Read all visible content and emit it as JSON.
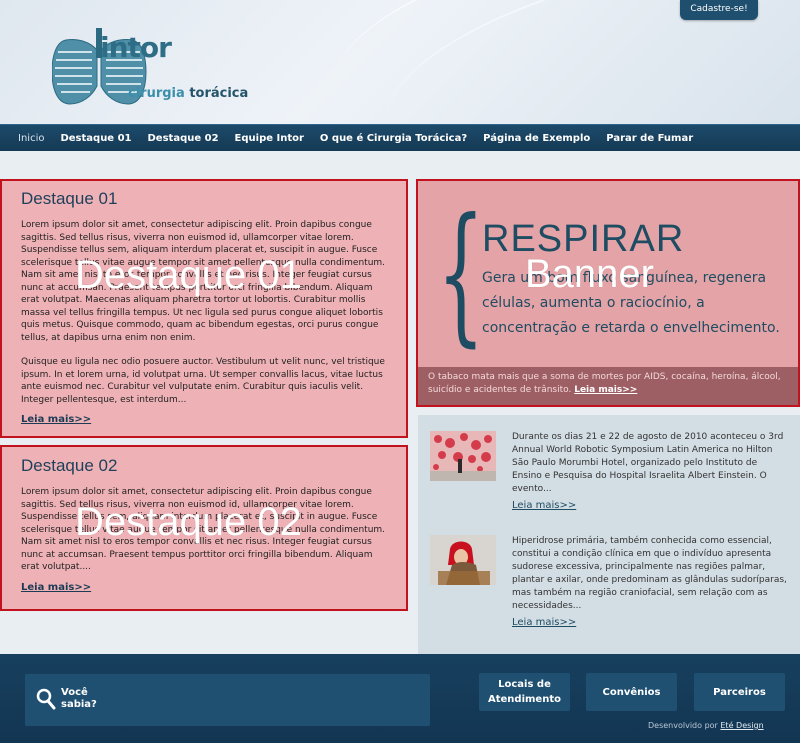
{
  "header": {
    "register_label": "Cadastre-se!",
    "logo_word": "intor",
    "logo_sub_1": "cirurgia",
    "logo_sub_2": "torácica"
  },
  "nav": {
    "items": [
      "Inicio",
      "Destaque 01",
      "Destaque 02",
      "Equipe Intor",
      "O que é Cirurgia Torácica?",
      "Página de Exemplo",
      "Parar de Fumar"
    ]
  },
  "featured1": {
    "title": "Destaque 01",
    "paragraph1": "Lorem ipsum dolor sit amet, consectetur adipiscing elit. Proin dapibus congue sagittis. Sed tellus risus, viverra non euismod id, ullamcorper vitae lorem. Suspendisse tellus sem, aliquam interdum placerat et, suscipit in augue. Fusce scelerisque tellus vitae augue tempor sit amet pellentesque nulla condimentum. Nam sit amet nisl to eros tempor convallis et nec risus. Integer feugiat cursus nunc at accumsan. Praesent tempus porttitor orci fringilla bibendum. Aliquam erat volutpat. Maecenas aliquam pharetra tortor ut lobortis. Curabitur mollis massa vel tellus fringilla tempus. Ut nec ligula sed purus congue aliquet lobortis quis metus. Quisque commodo, quam ac bibendum egestas, orci purus congue tellus, at dapibus urna enim non enim.",
    "paragraph2": "Quisque eu ligula nec odio posuere auctor. Vestibulum ut velit nunc, vel tristique ipsum. In et lorem urna, id volutpat urna. Ut semper convallis lacus, vitae luctus ante euismod nec. Curabitur vel vulputate enim. Curabitur quis iaculis velit. Integer pellentesque, est interdum...",
    "more": "Leia mais>>",
    "overlay": "Destaque 01"
  },
  "featured2": {
    "title": "Destaque 02",
    "paragraph1": "Lorem ipsum dolor sit amet, consectetur adipiscing elit. Proin dapibus congue sagittis. Sed tellus risus, viverra non euismod id, ullamcorper vitae lorem. Suspendisse tellus sem, aliquam interdum placerat et, suscipit in augue. Fusce scelerisque tellus vitae augue tempor sit amet pellentesque nulla condimentum. Nam sit amet nisl to eros tempor convallis et nec risus. Integer feugiat cursus nunc at accumsan. Praesent tempus porttitor orci fringilla bibendum. Aliquam erat volutpat....",
    "more": "Leia mais>>",
    "overlay": "Destaque 02"
  },
  "banner": {
    "heading": "RESPIRAR",
    "text": "Gera um bom fluxo sanguínea, regenera células, aumenta o raciocínio, a concentração e retarda o envelhecimento.",
    "footer_text": "O tabaco mata mais que a soma de mortes por AIDS, cocaína, heroína, álcool, suicídio e acidentes de trânsito.",
    "footer_link": "Leia mais>>",
    "overlay": "Banner"
  },
  "news": [
    {
      "text": "Durante os dias 21 e 22 de agosto de 2010 aconteceu o 3rd Annual World Robotic Symposium Latin America no Hilton São Paulo Morumbi Hotel, organizado pelo Instituto de Ensino e Pesquisa do Hospital Israelita Albert Einstein. O evento...",
      "more": "Leia mais>>"
    },
    {
      "text": "Hiperidrose primária, também conhecida como essencial, constitui a condição clínica em que o indivíduo apresenta sudorese excessiva, principalmente nas regiões palmar, plantar e axilar, onde predominam as glândulas sudoríparas, mas também na região craniofacial, sem relação com as necessidades...",
      "more": "Leia mais>>"
    }
  ],
  "footer": {
    "did_you_know": "Você sabia?",
    "buttons": [
      "Locais de Atendimento",
      "Convênios",
      "Parceiros"
    ],
    "credit_prefix": "Desenvolvido por",
    "credit_link": "Eté Design"
  },
  "colors": {
    "nav_bg": "#1d4a6a",
    "highlight_fill": "#eeb2b6",
    "highlight_border": "#c2121e",
    "brand_dark": "#1e4c62",
    "brand_light": "#3b8fab"
  }
}
